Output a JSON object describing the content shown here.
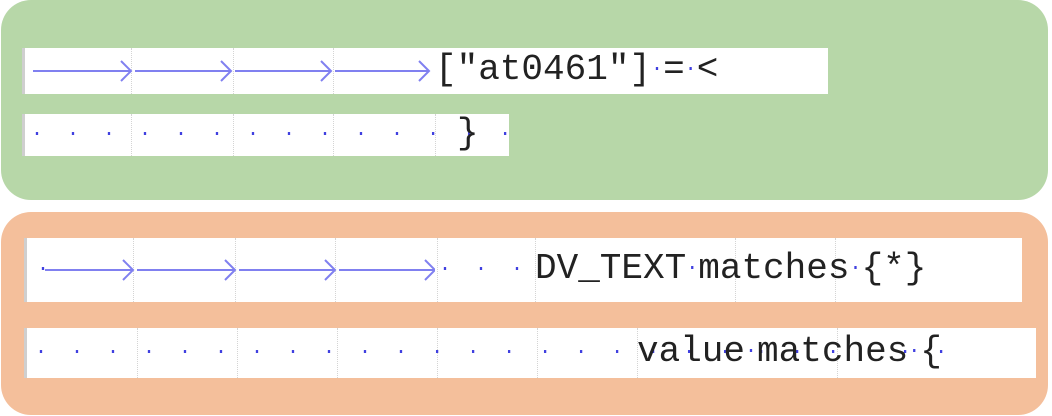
{
  "snippet_green": {
    "line_1": {
      "code": "[\"at0461\"]",
      "operator": "=",
      "tail": "<"
    },
    "line_2": {
      "code": "}"
    }
  },
  "snippet_orange": {
    "line_3": {
      "keyword": "DV_TEXT",
      "operator": "matches",
      "tail": "{*}"
    },
    "line_4": {
      "keyword": "value",
      "operator": "matches",
      "tail": "{"
    }
  },
  "colors": {
    "green_panel": "#b7d7a8",
    "orange_panel": "#f4bf9b",
    "whitespace_marker": "#3f3fe0",
    "tab_arrow": "#8080f0",
    "code_text": "#222222"
  },
  "icons": [
    "tab-arrow-icon",
    "space-dot-marker"
  ]
}
